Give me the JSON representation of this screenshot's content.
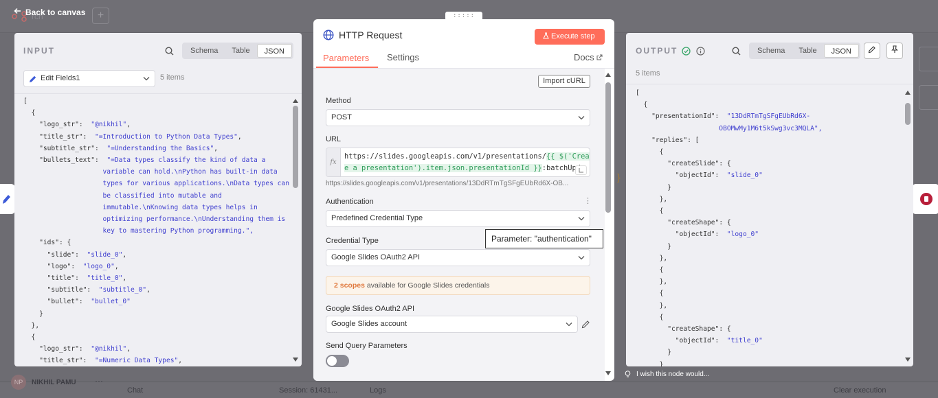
{
  "topbar": {
    "back_label": "Back to canvas",
    "hidden_name": "rch",
    "add_label": "+"
  },
  "bottombar": {
    "chat": "Chat",
    "session": "Session: 61431...",
    "logs": "Logs",
    "clear": "Clear execution",
    "user": "NIKHIL PAMU",
    "avatar": "NP"
  },
  "input": {
    "title": "INPUT",
    "tabs": [
      "Schema",
      "Table",
      "JSON"
    ],
    "active_tab": "JSON",
    "node_select": "Edit Fields1",
    "count": "5 items",
    "json_lines": [
      "[",
      "  {",
      "    \"logo_str\":  \"@nikhil\",",
      "    \"title_str\":  \"=Introduction to Python Data Types\",",
      "    \"subtitle_str\":  \"=Understanding the Basics\",",
      "    \"bullets_text\":  \"=Data types classify the kind of data a",
      "                    variable can hold.\\nPython has built-in data",
      "                    types for various applications.\\nData types can",
      "                    be classified into mutable and",
      "                    immutable.\\nKnowing data types helps in",
      "                    optimizing performance.\\nUnderstanding them is",
      "                    key to mastering Python programming.\",",
      "    \"ids\": {",
      "      \"slide\":  \"slide_0\",",
      "      \"logo\":  \"logo_0\",",
      "      \"title\":  \"title_0\",",
      "      \"subtitle\":  \"subtitle_0\",",
      "      \"bullet\":  \"bullet_0\"",
      "    }",
      "  },",
      "  {",
      "    \"logo_str\":  \"@nikhil\",",
      "    \"title_str\":  \"=Numeric Data Types\","
    ]
  },
  "node": {
    "title": "HTTP Request",
    "execute": "Execute step",
    "tabs": [
      "Parameters",
      "Settings"
    ],
    "docs": "Docs",
    "import_curl": "Import cURL",
    "method_label": "Method",
    "method_value": "POST",
    "url_label": "URL",
    "url_fx": "fx",
    "url_prefix": "https://slides.googleapis.com/v1/presentations/",
    "url_expr1": "{{ $('Creat",
    "url_expr2": "e a presentation').item.json.presentationId }}",
    "url_suffix": ":batchUpd",
    "url_resolved": "https://slides.googleapis.com/v1/presentations/13DdRTmTgSFgEUbRd6X-OB...",
    "auth_label": "Authentication",
    "auth_value": "Predefined Credential Type",
    "tooltip": "Parameter: \"authentication\"",
    "cred_type_label": "Credential Type",
    "cred_type_value": "Google Slides OAuth2 API",
    "scopes_bold": "2 scopes",
    "scopes_rest": " available for Google Slides credentials",
    "oauth_label": "Google Slides OAuth2 API",
    "oauth_value": "Google Slides account",
    "query_label": "Send Query Parameters",
    "drag_handle": ":::::"
  },
  "output": {
    "title": "OUTPUT",
    "tabs": [
      "Schema",
      "Table",
      "JSON"
    ],
    "active_tab": "JSON",
    "count": "5 items",
    "json_lines": [
      "[",
      "  {",
      "    \"presentationId\":  \"13DdRTmTgSFgEUbRd6X-",
      "                     OBOMwMy1M6t5kSwg3vc3MQLA\",",
      "    \"replies\": [",
      "      {",
      "        \"createSlide\": {",
      "          \"objectId\":  \"slide_0\"",
      "        }",
      "      },",
      "      {",
      "        \"createShape\": {",
      "          \"objectId\":  \"logo_0\"",
      "        }",
      "      },",
      "      {",
      "      },",
      "      {",
      "      },",
      "      {",
      "        \"createShape\": {",
      "          \"objectId\":  \"title_0\"",
      "        }",
      "      }"
    ],
    "wish": "I wish this node would..."
  },
  "colors": {
    "accent": "#ff6d5a",
    "panel_bg": "#efeff3",
    "string": "#3f3fcf"
  }
}
